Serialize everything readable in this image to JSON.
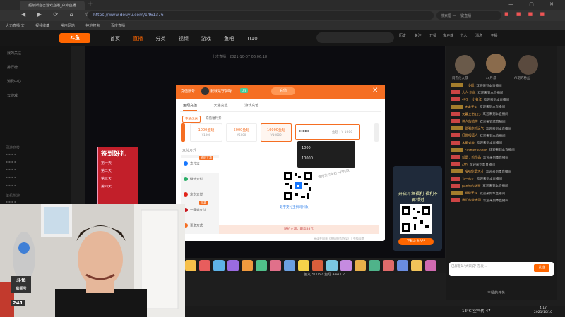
{
  "browser": {
    "tab_title": "超级斯自己游戏直播_户外直播",
    "new_tab": "+",
    "window_controls": "— ▢ ✕",
    "nav_buttons": "◀ ▶ ⟳ ⌂ ☆",
    "url": "https://www.douyu.com/1461376",
    "search_placeholder": "搜索框 — 一键直播",
    "ext_icons": "■ ■ ■ ■",
    "bookmarks": [
      "大力直播 文",
      "视频收藏",
      "常用网站",
      "神地搜索",
      "百度直播"
    ]
  },
  "site": {
    "logo": "斗鱼",
    "nav": [
      "首页",
      "直播",
      "分类",
      "视频",
      "游戏",
      "鱼吧",
      "TI10"
    ],
    "nav_active_index": 1,
    "search_placeholder": "",
    "header_icons": [
      "历史",
      "关注",
      "开播",
      "客户端",
      "个人",
      "消息",
      "主播"
    ]
  },
  "sidebar": {
    "items": [
      "我的关注",
      "排行榜",
      "消费中心",
      "云游戏"
    ],
    "section_1": "网游竞技",
    "section_2": "单机热游"
  },
  "stream": {
    "status_line": "上次直播：2021-10-07 06:06:18"
  },
  "sign_banner": {
    "title": "签到好礼",
    "lines": [
      "第一天",
      "第二天",
      "第三天",
      "第四天"
    ]
  },
  "promo_card": {
    "title": "开启斗鱼福利 福利不再错过",
    "button": "下载斗鱼APP"
  },
  "chat": {
    "fans": [
      "周杰伦大叔",
      "xx月叔",
      "Ai羽的粉丝"
    ],
    "messages": [
      {
        "user": "一小段",
        "text": "欢迎来到本直播间"
      },
      {
        "user": "大人·剑丝",
        "text": "欢迎来到本直播间"
      },
      {
        "user": "401 一小名汪",
        "text": "欢迎来到本直播间"
      },
      {
        "user": "大金子火",
        "text": "欢迎来到本直播间"
      },
      {
        "user": "天幕文书123",
        "text": "欢迎来到本直播间"
      },
      {
        "user": "神人的精神",
        "text": "欢迎来到本直播间"
      },
      {
        "user": "聪明你的运气",
        "text": "欢迎来到本直播间"
      },
      {
        "user": "打赏嘻嘻人",
        "text": "欢迎来到本直播间"
      },
      {
        "user": "木甲对敌",
        "text": "欢迎来到本直播间"
      },
      {
        "user": "cashier Apollo",
        "text": "欢迎来到本直播间"
      },
      {
        "user": "就是了的作品",
        "text": "欢迎来到本直播间"
      },
      {
        "user": "Zth",
        "text": "欢迎来到本直播间"
      },
      {
        "user": "哈哈你是天才",
        "text": "欢迎来到本直播间"
      },
      {
        "user": "为一的了",
        "text": "欢迎来到本直播间"
      },
      {
        "user": "pan的的路哥",
        "text": "欢迎来到本直播间"
      },
      {
        "user": "超级无双",
        "text": "欢迎来到本直播间"
      },
      {
        "user": "我们的数大同",
        "text": "欢迎来到本直播间"
      }
    ],
    "input_placeholder": "已屏蔽1.\"大家说\" 在发…",
    "send": "发送",
    "below": "主播的任务"
  },
  "gift_bar": {
    "below_text": "鱼丸 50052  鱼翅 4443.2"
  },
  "recharge_modal": {
    "header_label": "充值账号：",
    "user_name": "我就是守护呀",
    "user_level": "LV8",
    "recharge_pill": "充值",
    "close": "✕",
    "tabs": [
      "鱼翅充值",
      "天猫充值",
      "游戏充值"
    ],
    "active_tab": 0,
    "subtabs": [
      "充值优惠",
      "充值福利券"
    ],
    "packs": [
      {
        "amount": "1000鱼翅",
        "price": "¥1000"
      },
      {
        "amount": "5000鱼翅",
        "price": "¥5000"
      },
      {
        "amount": "10000鱼翅",
        "price": "¥10000"
      }
    ],
    "custom_value": "1000",
    "custom_suffix": "鱼翅 | ¥ 1000",
    "pay_label": "支付方式",
    "pay_methods": [
      "支付宝",
      "微信支付",
      "京东支付",
      "一网通支付",
      "更多方式"
    ],
    "pay_promo": "随机立减",
    "pay_promo2": "立减",
    "qr_caption": "数字支付宝扫码付款",
    "qr_note": "使用支付宝扫一扫付款",
    "footer": "随机立减，最高88元",
    "agree": "阅读并同意《充值服务协议》 | 充值异常",
    "dropdown_options": [
      "1000",
      "10000"
    ]
  },
  "webcam": {
    "logo": "斗鱼",
    "logo_sub": "房间号",
    "room": "241"
  },
  "taskbar": {
    "weather": "13°C 空气优 47",
    "time": "4:17",
    "date": "2021/10/10"
  }
}
